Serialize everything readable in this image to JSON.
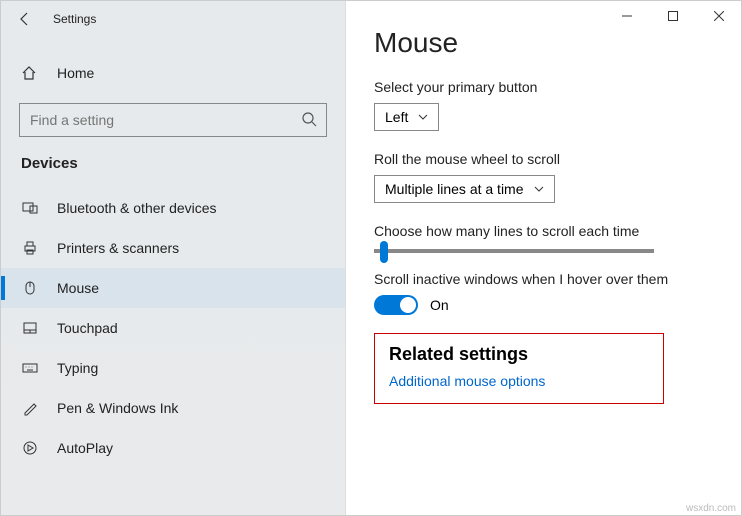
{
  "titlebar": {
    "title": "Settings"
  },
  "home": {
    "label": "Home"
  },
  "search": {
    "placeholder": "Find a setting"
  },
  "section": {
    "header": "Devices"
  },
  "nav": {
    "items": [
      {
        "label": "Bluetooth & other devices"
      },
      {
        "label": "Printers & scanners"
      },
      {
        "label": "Mouse"
      },
      {
        "label": "Touchpad"
      },
      {
        "label": "Typing"
      },
      {
        "label": "Pen & Windows Ink"
      },
      {
        "label": "AutoPlay"
      }
    ]
  },
  "page": {
    "title": "Mouse",
    "primary_button_label": "Select your primary button",
    "primary_button_value": "Left",
    "scroll_label": "Roll the mouse wheel to scroll",
    "scroll_value": "Multiple lines at a time",
    "lines_label": "Choose how many lines to scroll each time",
    "inactive_label": "Scroll inactive windows when I hover over them",
    "toggle_state": "On",
    "related_header": "Related settings",
    "related_link": "Additional mouse options"
  },
  "watermark": "wsxdn.com"
}
